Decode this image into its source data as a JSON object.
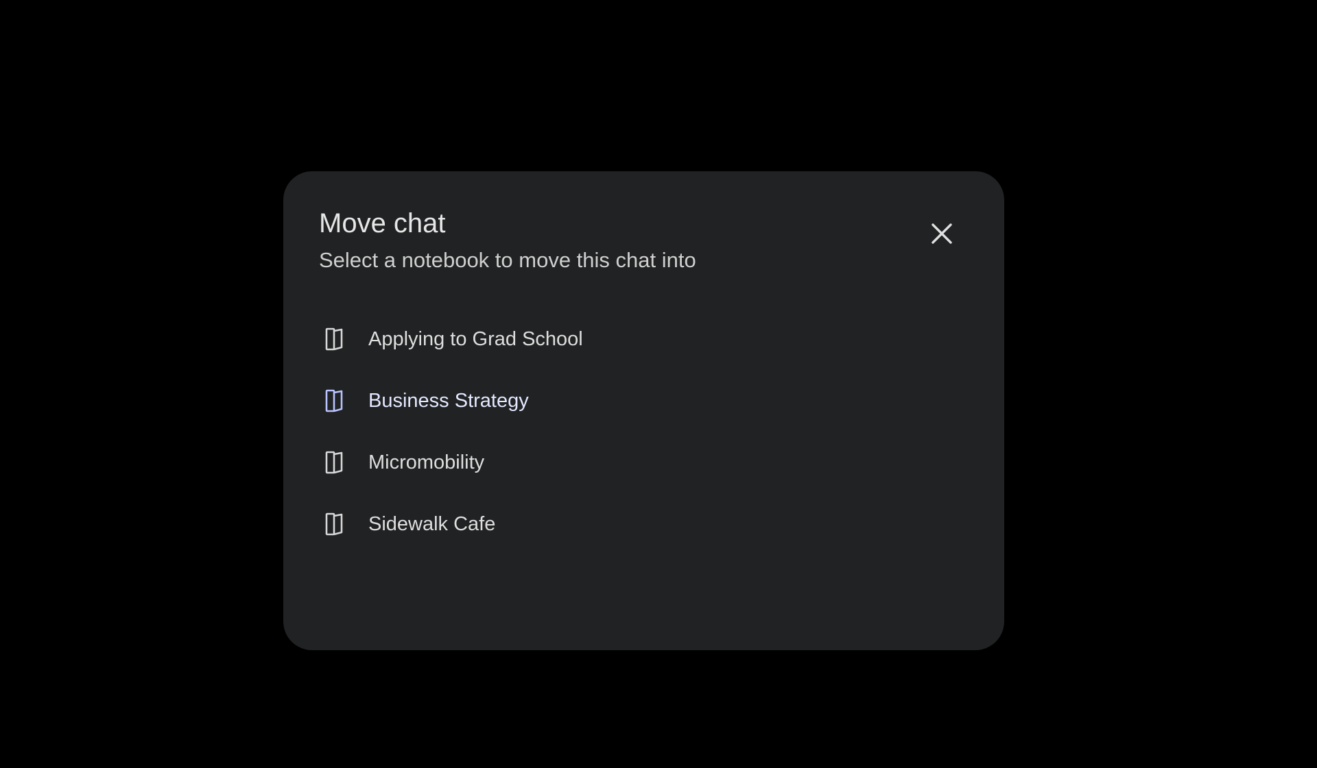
{
  "dialog": {
    "title": "Move chat",
    "subtitle": "Select a notebook to move this chat into",
    "close_icon": "close-icon"
  },
  "notebooks": [
    {
      "label": "Applying to Grad School",
      "icon": "notebook-icon",
      "highlighted": false
    },
    {
      "label": "Business Strategy",
      "icon": "notebook-icon",
      "highlighted": true
    },
    {
      "label": "Micromobility",
      "icon": "notebook-icon",
      "highlighted": false
    },
    {
      "label": "Sidewalk Cafe",
      "icon": "notebook-icon",
      "highlighted": false
    }
  ],
  "colors": {
    "background": "#000000",
    "dialog": "#212223",
    "icon_default": "#d8d8d8",
    "icon_highlighted": "#b9c3ff"
  }
}
